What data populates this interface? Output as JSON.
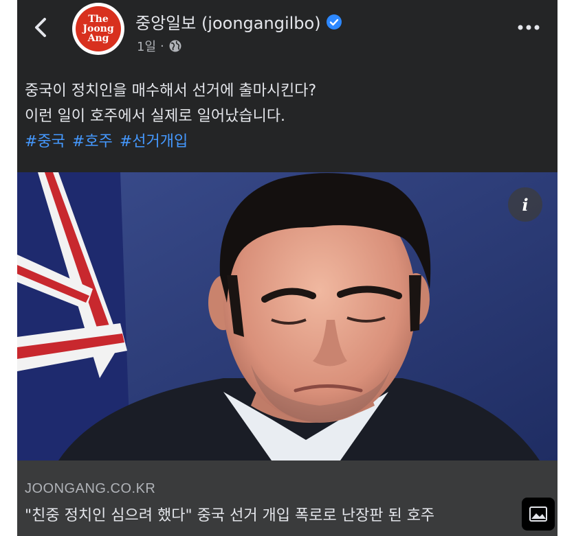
{
  "header": {
    "page_name": "중앙일보 (joongangilbo)",
    "time": "1일",
    "separator": "·",
    "logo_line1": "The",
    "logo_line2": "Joong",
    "logo_line3": "Ang",
    "icons": {
      "back": "chevron-left-icon",
      "verified": "verified-badge-icon",
      "privacy": "globe-icon",
      "more": "more-horizontal-icon"
    }
  },
  "caption": {
    "line1": "중국이 정치인을 매수해서 선거에 출마시킨다?",
    "line2": "이런 일이 호주에서 실제로 일어났습니다.",
    "hashtags": [
      "#중국",
      "#호주",
      "#선거개입"
    ]
  },
  "photo": {
    "info_label": "i"
  },
  "link": {
    "domain": "JOONGANG.CO.KR",
    "title": "\"친중 정치인 심으려 했다\" 중국 선거 개입 폭로로 난장판 된 호주",
    "icon": "image-icon"
  },
  "colors": {
    "background": "#242526",
    "link_footer": "#3a3b3c",
    "hashtag": "#4599ff",
    "verified": "#2d88ff",
    "logo_red": "#d8301e"
  }
}
